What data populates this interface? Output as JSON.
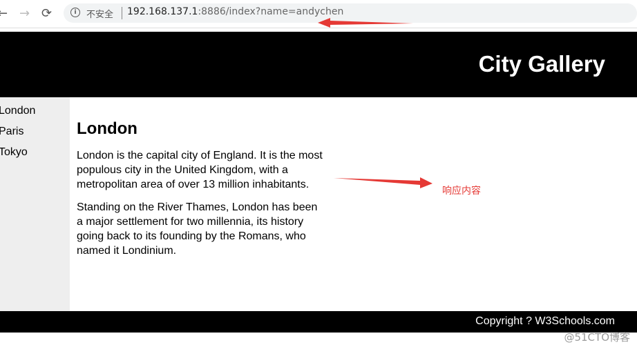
{
  "browser": {
    "back": "←",
    "forward": "→",
    "reload": "⟳",
    "info": "i",
    "security": "不安全",
    "url_host": "192.168.137.1",
    "url_rest": ":8886/index?name=andychen"
  },
  "header": {
    "title": "City Gallery"
  },
  "sidebar": {
    "items": [
      {
        "label": "London"
      },
      {
        "label": "Paris"
      },
      {
        "label": "Tokyo"
      }
    ]
  },
  "main": {
    "heading": "London",
    "paragraphs": [
      "London is the capital city of England. It is the most populous city in the United Kingdom, with a metropolitan area of over 13 million inhabitants.",
      "Standing on the River Thames, London has been a major settlement for two millennia, its history going back to its founding by the Romans, who named it Londinium."
    ]
  },
  "footer": {
    "text": "Copyright ? W3Schools.com"
  },
  "annotation": {
    "text": "响应内容",
    "color": "#e53935"
  },
  "watermark": "@51CTO博客"
}
